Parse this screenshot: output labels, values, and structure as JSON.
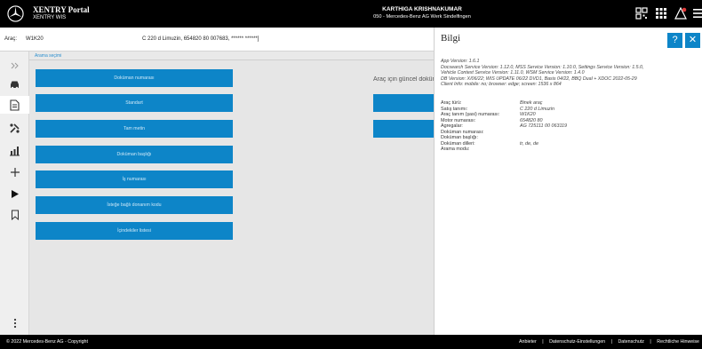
{
  "header": {
    "brand_title": "XENTRY Portal",
    "brand_subtitle": "XENTRY WIS",
    "user_name": "KARTHIGA KRISHNAKUMAR",
    "user_org": "050 - Mercedes-Benz AG Werk Sindelfingen",
    "icons": [
      "mercedes-star-logo",
      "qr-code-icon",
      "apps-grid-icon",
      "alert-icon",
      "menu-icon"
    ]
  },
  "vehicle": {
    "label": "Araç:",
    "vin": "W1K20",
    "description": "C 220 d Limuzin, 654820 80 007683, ****** ******]"
  },
  "nav": {
    "icons": [
      "collapse-icon",
      "car-icon",
      "document-icon",
      "repair-icon",
      "chart-icon",
      "plus-icon",
      "play-icon",
      "bookmark-icon",
      "more-icon"
    ]
  },
  "main": {
    "breadcrumb": "Arama seçimi",
    "buttons": [
      "Doküman numarası",
      "Standart",
      "Tam metin",
      "Doküman başlığı",
      "İş numarası",
      "İsteğe bağlı donanım kodu",
      "İçindekiler listesi"
    ],
    "right_title": "Araç için güncel doküman"
  },
  "panel": {
    "title": "Bilgi",
    "help_label": "?",
    "close_label": "✕",
    "version_lines": [
      "App Version: 1.6.1",
      "Docsearch Service Version: 1.12.0, MSS Service Version: 1.10.0, Settings Service Version: 1.5.0,",
      "Vehicle Context Service Version: 1.11.0, WSM Service Version: 1.4.0",
      "DB Version: X/06/22; WIS UPDATE 06/22 DVD1, Basis 04/22, BBQ Dual + XDOC 2022-05-29",
      "Client Info: mobile: no; browser: edge; screen: 1536 x 864"
    ],
    "details": [
      {
        "key": "Araç türü:",
        "value": "Binek araç"
      },
      {
        "key": "Satış tanımı:",
        "value": "C 220 d Limuzin"
      },
      {
        "key": "Araç tanım (şasi) numarası:",
        "value": "W1K20"
      },
      {
        "key": "Motor numarası:",
        "value": "654820 80"
      },
      {
        "key": "Agregalar:",
        "value": "AG 725111 00 063119"
      },
      {
        "key": "Doküman numarası:",
        "value": ""
      },
      {
        "key": "Doküman başlığı:",
        "value": ""
      },
      {
        "key": "Doküman dilleri:",
        "value": "tr, de, de"
      },
      {
        "key": "Arama modu:",
        "value": ""
      }
    ]
  },
  "footer": {
    "copyright": "© 2022 Mercedes-Benz AG - Copyright",
    "links": [
      "Anbieter",
      "Datenschutz-Einstellungen",
      "Datenschutz",
      "Rechtliche Hinweise"
    ],
    "separator": "|"
  },
  "colors": {
    "primary_blue": "#0d85c8",
    "header_bg": "#000000",
    "content_bg": "#e6e6e6"
  }
}
